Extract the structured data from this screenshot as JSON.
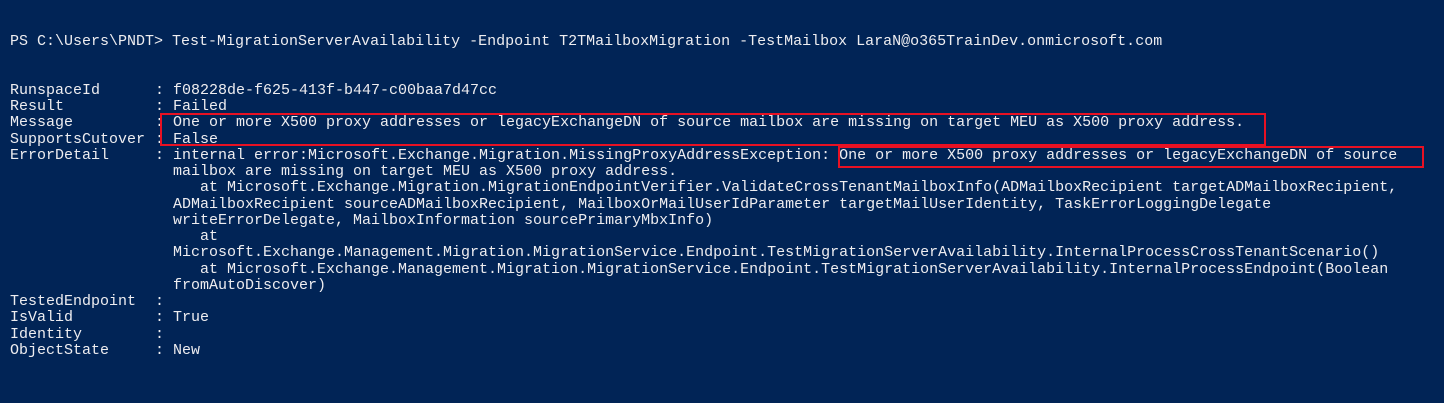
{
  "prompt": "PS C:\\Users\\PNDT> ",
  "command": "Test-MigrationServerAvailability -Endpoint T2TMailboxMigration -TestMailbox LaraN@o365TrainDev.onmicrosoft.com",
  "separator": ": ",
  "fields": [
    {
      "label": "RunspaceId",
      "value": "f08228de-f625-413f-b447-c00baa7d47cc"
    },
    {
      "label": "Result",
      "value": "Failed"
    },
    {
      "label": "Message",
      "value": "One or more X500 proxy addresses or legacyExchangeDN of source mailbox are missing on target MEU as X500 proxy address."
    },
    {
      "label": "SupportsCutover",
      "value": "False"
    },
    {
      "label": "ErrorDetail",
      "value": "internal error:Microsoft.Exchange.Migration.MissingProxyAddressException: One or more X500 proxy addresses or legacyExchangeDN of source",
      "continuation": [
        "mailbox are missing on target MEU as X500 proxy address.",
        "   at Microsoft.Exchange.Migration.MigrationEndpointVerifier.ValidateCrossTenantMailboxInfo(ADMailboxRecipient targetADMailboxRecipient,",
        "ADMailboxRecipient sourceADMailboxRecipient, MailboxOrMailUserIdParameter targetMailUserIdentity, TaskErrorLoggingDelegate",
        "writeErrorDelegate, MailboxInformation sourcePrimaryMbxInfo)",
        "   at",
        "Microsoft.Exchange.Management.Migration.MigrationService.Endpoint.TestMigrationServerAvailability.InternalProcessCrossTenantScenario()",
        "   at Microsoft.Exchange.Management.Migration.MigrationService.Endpoint.TestMigrationServerAvailability.InternalProcessEndpoint(Boolean",
        "fromAutoDiscover)"
      ]
    },
    {
      "label": "TestedEndpoint",
      "value": ""
    },
    {
      "label": "IsValid",
      "value": "True"
    },
    {
      "label": "Identity",
      "value": ""
    },
    {
      "label": "ObjectState",
      "value": "New"
    }
  ],
  "colors": {
    "background": "#012456",
    "text": "#eeedf0",
    "highlight_box": "#e81123"
  }
}
